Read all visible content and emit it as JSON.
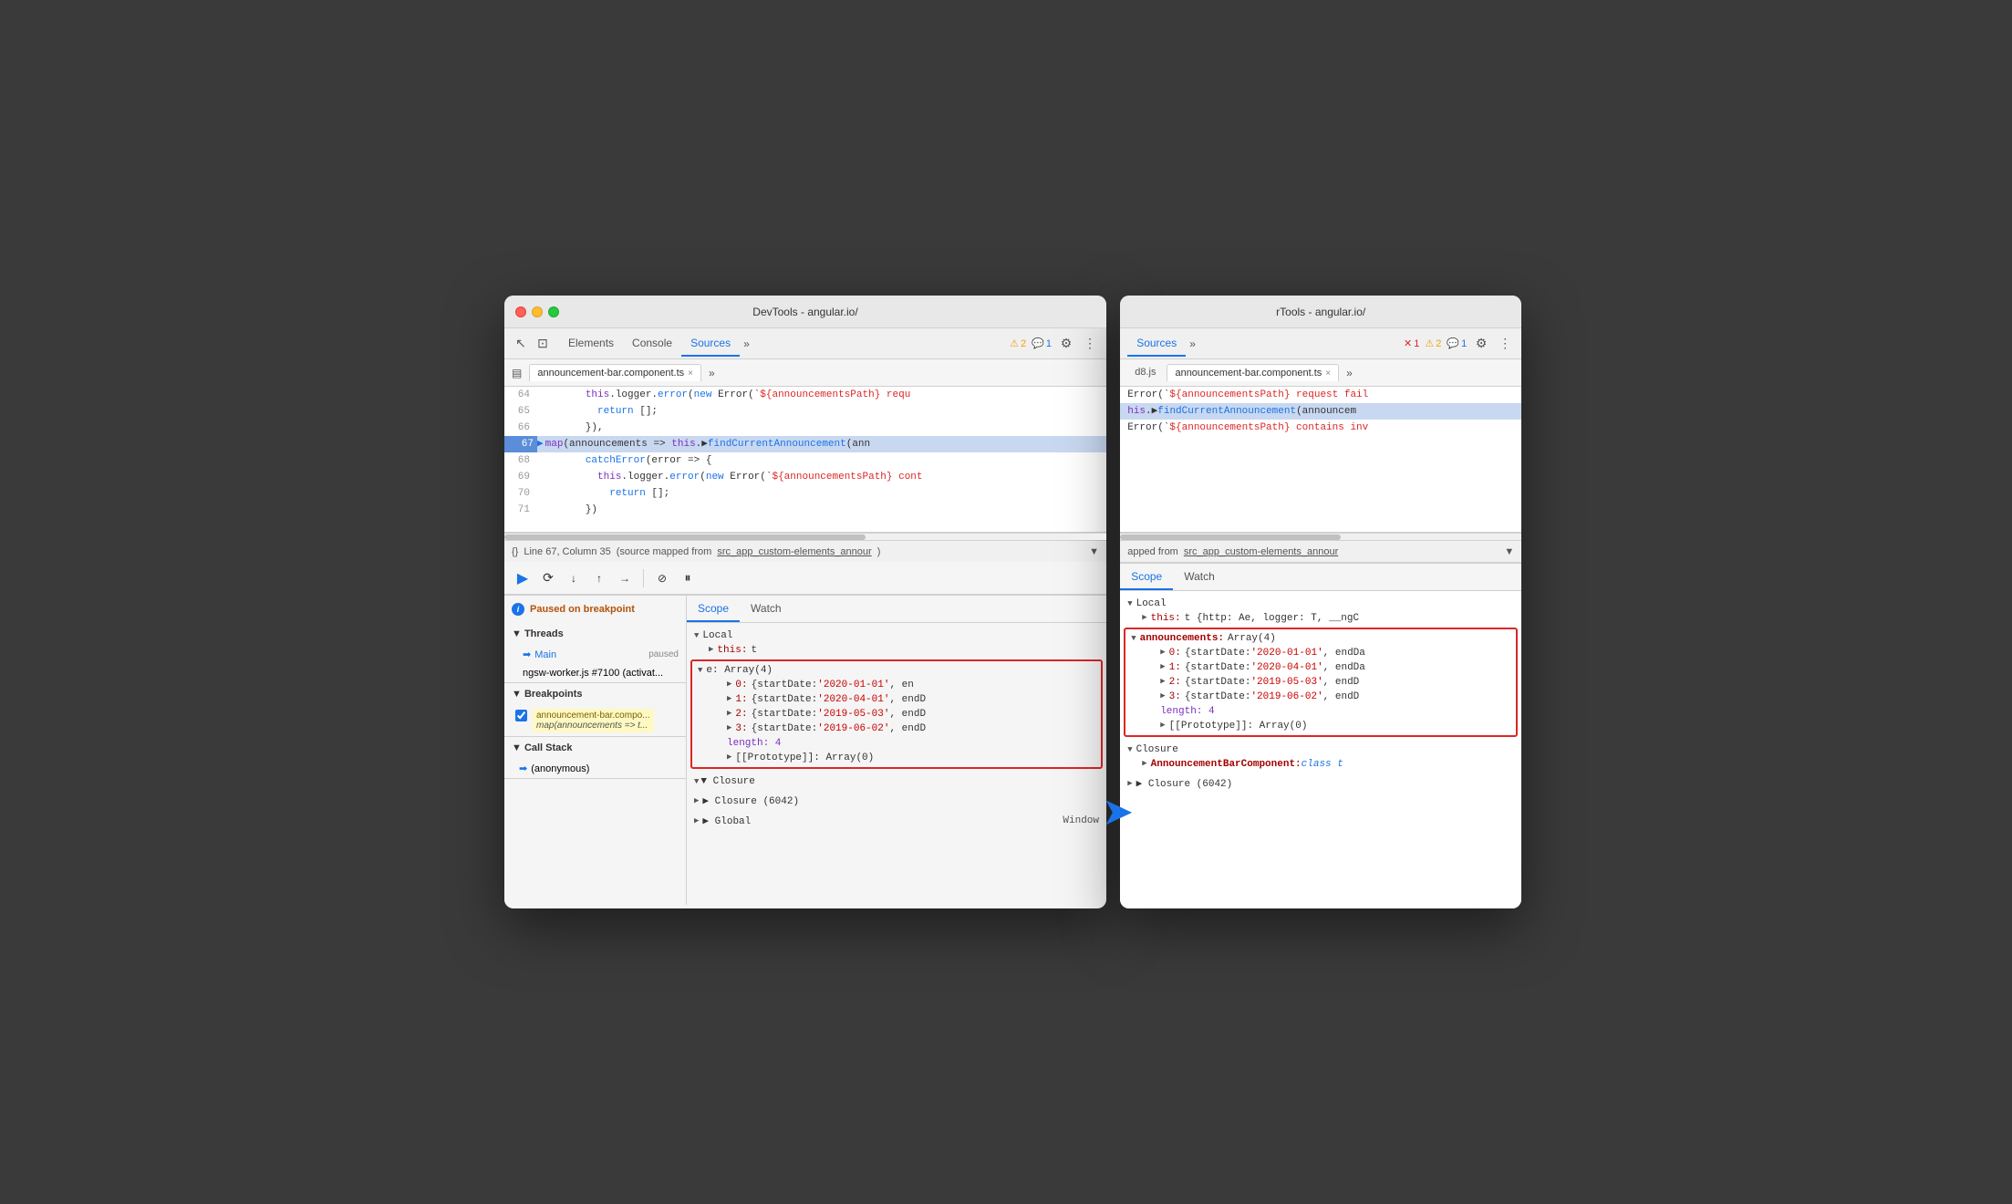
{
  "left_window": {
    "title": "DevTools - angular.io/",
    "tabs": {
      "elements": "Elements",
      "console": "Console",
      "sources": "Sources",
      "more": "»",
      "warning_count": "2",
      "chat_count": "1"
    },
    "file_tab": {
      "name": "announcement-bar.component.ts",
      "close": "×",
      "more": "»"
    },
    "code_lines": [
      {
        "num": "64",
        "content": "        this.logger.error(new Error(`${announcementsPath} requ",
        "highlighted": false
      },
      {
        "num": "65",
        "content": "          return [];",
        "highlighted": false
      },
      {
        "num": "66",
        "content": "        }),",
        "highlighted": false
      },
      {
        "num": "67",
        "content": "  ▶map(announcements => this.▶findCurrentAnnouncement(ann",
        "highlighted": true
      },
      {
        "num": "68",
        "content": "        catchError(error => {",
        "highlighted": false
      },
      {
        "num": "69",
        "content": "          this.logger.error(new Error(`${announcementsPath} cont",
        "highlighted": false
      },
      {
        "num": "70",
        "content": "            return [];",
        "highlighted": false
      },
      {
        "num": "71",
        "content": "        })",
        "highlighted": false
      }
    ],
    "status_bar": {
      "format": "{}",
      "position": "Line 67, Column 35",
      "source_mapped": "(source mapped from",
      "link": "src_app_custom-elements_annour"
    },
    "debug_toolbar": {
      "resume": "▶",
      "pause": "⏸",
      "step_over": "↷",
      "step_into": "↓",
      "step_out": "↑",
      "step": "→"
    },
    "left_panel": {
      "paused_label": "Paused on breakpoint",
      "threads_header": "▼ Threads",
      "main_thread": "Main",
      "main_status": "paused",
      "worker": "ngsw-worker.js #7100 (activat...",
      "breakpoints_header": "▼ Breakpoints",
      "bp_filename": "announcement-bar.compo...",
      "bp_code": "map(announcements => t...",
      "call_stack_header": "▼ Call Stack",
      "call_item": "(anonymous)"
    },
    "scope": {
      "tab_scope": "Scope",
      "tab_watch": "Watch",
      "local_header": "▼ Local",
      "this_item": "this: t",
      "e_box_label": "e: Array(4)",
      "item0": "▶ 0: {startDate: '2020-01-01', en",
      "item1": "▶ 1: {startDate: '2020-04-01', endD",
      "item2": "▶ 2: {startDate: '2019-05-03', endD",
      "item3": "▶ 3: {startDate: '2019-06-02', endD",
      "length": "length: 4",
      "prototype": "▶ [[Prototype]]: Array(0)",
      "closure_header": "▼ Closure",
      "closure2_header": "▶ Closure (6042)",
      "global_header": "▶ Global",
      "global_val": "Window"
    }
  },
  "right_window": {
    "title": "rTools - angular.io/",
    "tabs": {
      "sources": "Sources",
      "more": "»",
      "error_count": "1",
      "warning_count": "2",
      "chat_count": "1"
    },
    "file_tabs": {
      "d8js": "d8.js",
      "announcement": "announcement-bar.component.ts",
      "close": "×",
      "more": "»"
    },
    "code_lines": [
      {
        "content": "Error(`${announcementsPath} request fail"
      },
      {
        "content": "his.▶findCurrentAnnouncement(announcem",
        "highlighted": true
      },
      {
        "content": "Error(`${announcementsPath} contains inv"
      }
    ],
    "status_bar": {
      "label": "apped from",
      "link": "src_app_custom-elements_annour"
    },
    "scope": {
      "tab_scope": "Scope",
      "tab_watch": "Watch",
      "local_header": "▼ Local",
      "this_item": "this: t {http: Ae, logger: T, __ngC",
      "announcements_label": "announcements: Array(4)",
      "item0": "▶ 0: {startDate: '2020-01-01', endDa",
      "item1": "▶ 1: {startDate: '2020-04-01', endDa",
      "item2": "▶ 2: {startDate: '2019-05-03', endD",
      "item3": "▶ 3: {startDate: '2019-06-02', endD",
      "length": "length: 4",
      "prototype": "▶ [[Prototype]]: Array(0)",
      "closure_header": "▼ Closure",
      "ann_component": "▶ AnnouncementBarComponent:",
      "ann_value": "class t",
      "closure2_header": "▶ Closure (6042)"
    }
  },
  "icons": {
    "cursor": "↖",
    "layers": "⊞",
    "warning": "⚠",
    "chat": "💬",
    "gear": "⚙",
    "dots": "⋮",
    "chevron_right": "▶",
    "chevron_down": "▼",
    "arrow_right": "→",
    "close": "×",
    "blue_arrow": "➤",
    "info": "i",
    "breakpoint": "●",
    "thread_arrow": "➡"
  }
}
